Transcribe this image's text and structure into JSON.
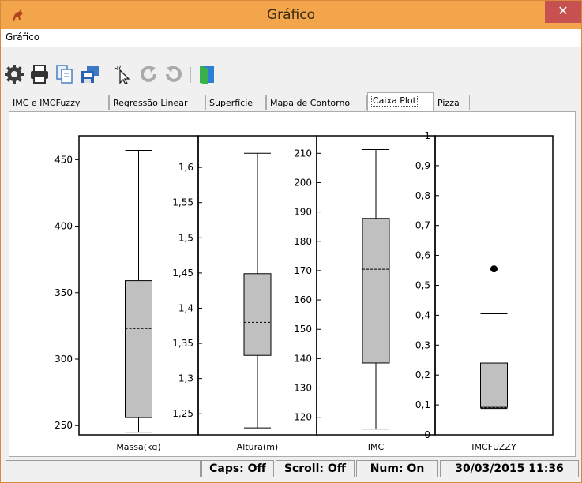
{
  "window": {
    "title": "Gráfico",
    "close": "✕"
  },
  "menu": {
    "items": [
      "Gráfico"
    ]
  },
  "toolbar": [
    "gear-icon",
    "print-icon",
    "copy-icon",
    "save-icon",
    "pointer-icon",
    "rotate-cw-icon",
    "rotate-ccw-icon",
    "exit-icon"
  ],
  "tabs": [
    "IMC e IMCFuzzy",
    "Regressão Linear",
    "Superfície",
    "Mapa de Contorno",
    "Caixa Plot",
    "Pizza"
  ],
  "active_tab": "Caixa Plot",
  "status": {
    "caps": "Caps: Off",
    "scroll": "Scroll: Off",
    "num": "Num: On",
    "datetime": "30/03/2015 11:36"
  },
  "chart_data": [
    {
      "type": "box",
      "category": "Massa(kg)",
      "ylim": [
        243,
        468
      ],
      "ticks": [
        250,
        300,
        350,
        400,
        450
      ],
      "tick_labels": [
        "250",
        "300",
        "350",
        "400",
        "450"
      ],
      "whisker_low": 245,
      "q1": 256,
      "median": 323,
      "q3": 359,
      "whisker_high": 457,
      "outliers": []
    },
    {
      "type": "box",
      "category": "Altura(m)",
      "ylim": [
        1.22,
        1.645
      ],
      "ticks": [
        1.25,
        1.3,
        1.35,
        1.4,
        1.45,
        1.5,
        1.55,
        1.6
      ],
      "tick_labels": [
        "1,25",
        "1,3",
        "1,35",
        "1,4",
        "1,45",
        "1,5",
        "1,55",
        "1,6"
      ],
      "whisker_low": 1.23,
      "q1": 1.333,
      "median": 1.38,
      "q3": 1.449,
      "whisker_high": 1.62,
      "outliers": []
    },
    {
      "type": "box",
      "category": "IMC",
      "ylim": [
        114,
        216
      ],
      "ticks": [
        120,
        130,
        140,
        150,
        160,
        170,
        180,
        190,
        200,
        210
      ],
      "tick_labels": [
        "120",
        "130",
        "140",
        "150",
        "160",
        "170",
        "180",
        "190",
        "200",
        "210"
      ],
      "whisker_low": 116,
      "q1": 138.5,
      "median": 170.5,
      "q3": 187.8,
      "whisker_high": 211.3,
      "outliers": []
    },
    {
      "type": "box",
      "category": "IMCFUZZY",
      "ylim": [
        0,
        1
      ],
      "ticks": [
        0,
        0.1,
        0.2,
        0.3,
        0.4,
        0.5,
        0.6,
        0.7,
        0.8,
        0.9,
        1
      ],
      "tick_labels": [
        "0",
        "0,1",
        "0,2",
        "0,3",
        "0,4",
        "0,5",
        "0,6",
        "0,7",
        "0,8",
        "0,9",
        "1"
      ],
      "whisker_low": 0.088,
      "q1": 0.092,
      "median": 0.09,
      "q3": 0.24,
      "whisker_high": 0.405,
      "outliers": [
        0.555
      ]
    }
  ]
}
